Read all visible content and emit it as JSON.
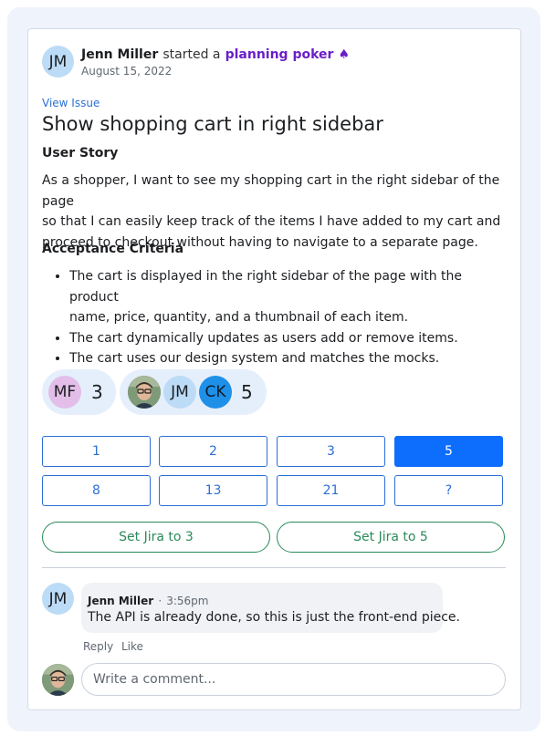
{
  "header": {
    "avatar_initials": "JM",
    "user_name": "Jenn Miller",
    "action_text": "started a",
    "activity_link": "planning poker",
    "suit_icon": "spade-icon",
    "date": "August 15, 2022"
  },
  "issue": {
    "view_link": "View Issue",
    "title": "Show shopping cart in right sidebar",
    "user_story_heading": "User Story",
    "user_story_lines": [
      "As a shopper, I want to see my shopping cart in the right sidebar of the page",
      "so that I can easily keep track of the items I have added to my cart and",
      "proceed to checkout without having to navigate to a separate page."
    ],
    "acceptance_heading": "Acceptance Criteria",
    "acceptance_items": [
      {
        "line1": "The cart is displayed in the right sidebar of the page with the product",
        "line2": "name, price, quantity, and a thumbnail of each item."
      },
      {
        "line1": "The cart dynamically updates as users add or remove items.",
        "line2": ""
      },
      {
        "line1": "The cart uses our design system and matches the mocks.",
        "line2": ""
      }
    ]
  },
  "votes": {
    "group1": {
      "voters": [
        "MF"
      ],
      "value": "3"
    },
    "group2": {
      "voters": [
        "photo",
        "JM",
        "CK"
      ],
      "value": "5"
    }
  },
  "options": {
    "row1": [
      "1",
      "2",
      "3",
      "5"
    ],
    "row2": [
      "8",
      "13",
      "21",
      "?"
    ],
    "selected": "5"
  },
  "jira": {
    "button1": "Set Jira to 3",
    "button2": "Set Jira to 5"
  },
  "comment": {
    "avatar_initials": "JM",
    "author": "Jenn Miller",
    "separator": "·",
    "time": "3:56pm",
    "text": "The API is already done, so this is just the front-end piece.",
    "reply": "Reply",
    "like": "Like"
  },
  "composer": {
    "placeholder": "Write a comment..."
  },
  "colors": {
    "accent": "#0d6efd",
    "link": "#2d6fd6",
    "poker": "#6a1fc9",
    "jira": "#2a8a5a"
  }
}
